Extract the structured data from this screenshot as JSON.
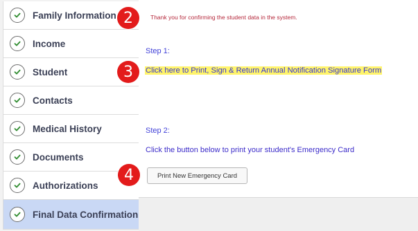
{
  "sidebar": {
    "items": [
      {
        "label": "Family Information",
        "icon": "check-circle-icon"
      },
      {
        "label": "Income",
        "icon": "check-circle-icon"
      },
      {
        "label": "Student",
        "icon": "check-circle-icon"
      },
      {
        "label": "Contacts",
        "icon": "check-circle-icon"
      },
      {
        "label": "Medical History",
        "icon": "check-circle-icon"
      },
      {
        "label": "Documents",
        "icon": "check-circle-icon"
      },
      {
        "label": "Authorizations",
        "icon": "check-circle-icon"
      },
      {
        "label": "Final Data Confirmation",
        "icon": "check-circle-icon",
        "active": true
      }
    ]
  },
  "main": {
    "thanks_message": "Thank you for confirming the student data in the system.",
    "step1_label": "Step 1:",
    "step1_link": "Click here to Print, Sign & Return Annual Notification Signature Form",
    "step2_label": "Step 2:",
    "step2_instruction": "Click the button below to print your student's Emergency Card",
    "print_button_label": "Print New Emergency Card"
  },
  "callouts": {
    "two": "2",
    "three": "3",
    "four": "4"
  },
  "colors": {
    "active_item_bg": "#c9d8f5",
    "check_green": "#2e8b2e",
    "link_highlight": "#fff46a",
    "callout_red": "#e31b1b",
    "thanks_red": "#b5283b",
    "step_blue": "#4040d8"
  }
}
